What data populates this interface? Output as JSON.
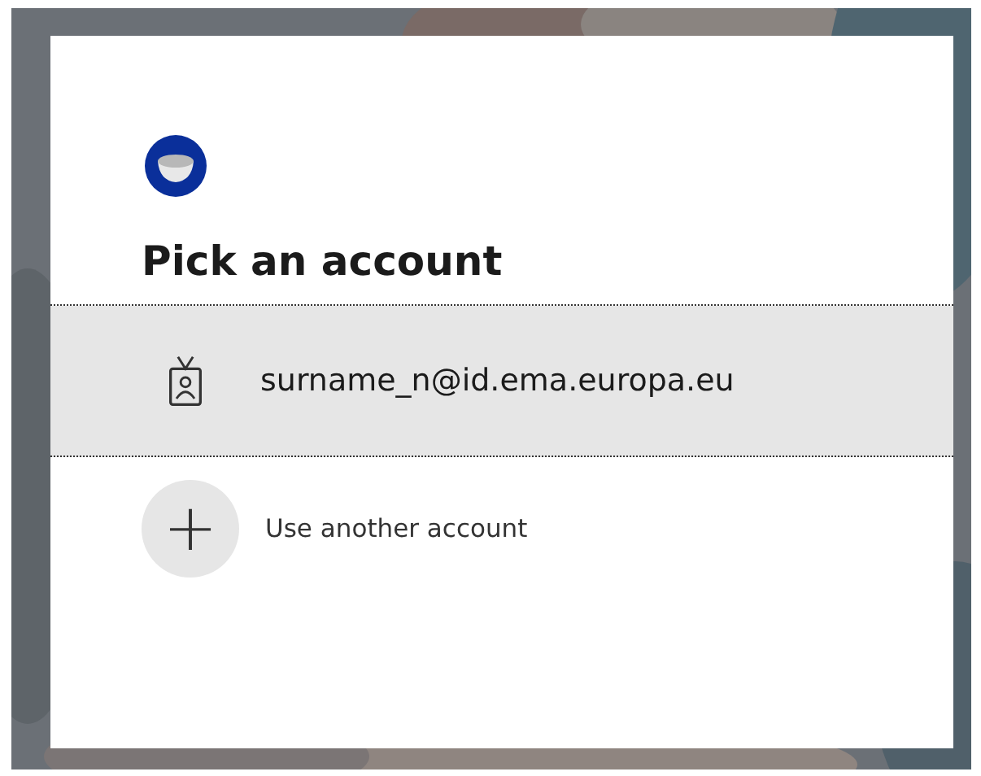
{
  "dialog": {
    "title": "Pick an account"
  },
  "accounts": [
    {
      "kind": "account",
      "label": "surname_n@id.ema.europa.eu",
      "selected": true
    },
    {
      "kind": "add",
      "icon": "+",
      "label": "Use another account",
      "selected": false
    }
  ]
}
